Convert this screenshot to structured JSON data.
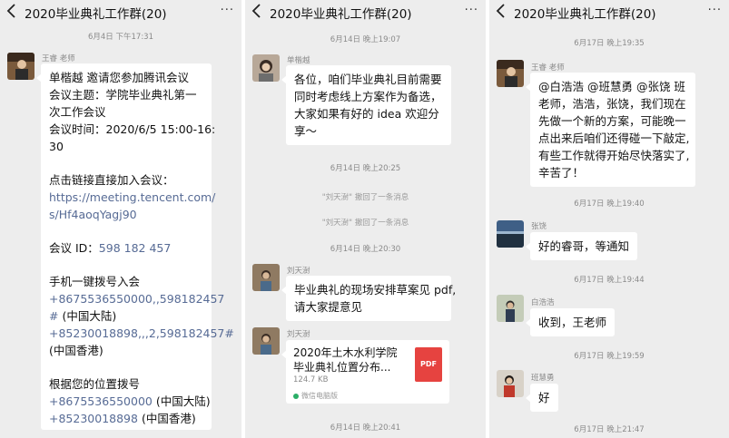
{
  "panels": [
    {
      "title": "2020毕业典礼工作群(20)",
      "more": "···",
      "timestamp": "6月4日 下午17:31",
      "sender": "王睿 老师",
      "lines": [
        "单楷越 邀请您参加腾讯会议",
        "会议主题：学院毕业典礼第一",
        "次工作会议",
        "会议时间：2020/6/5 15:00-16:",
        "30",
        "",
        "点击链接直接加入会议：",
        "https://meeting.tencent.com/",
        "s/Hf4aoqYagj90",
        "",
        "会议 ID：",
        "",
        "手机一键拨号入会",
        "+8675536550000,,598182457",
        "#",
        "+85230018898,,,2,598182457#",
        " (中国香港)",
        "",
        "根据您的位置拨号",
        "+8675536550000",
        "+85230018898"
      ],
      "meeting_id": "598 182 457",
      "cn_mainland_suffix": " (中国大陆)",
      "cn_mainland": " (中国大陆)",
      "hk": " (中国香港)"
    },
    {
      "title": "2020毕业典礼工作群(20)",
      "more": "···",
      "t1": "6月14日 晚上19:07",
      "sender1": "单楷越",
      "msg1": [
        "各位，咱们毕业典礼目前需要",
        "同时考虑线上方案作为备选，",
        "大家如果有好的 idea 欢迎分",
        "享～"
      ],
      "t2": "6月14日 晚上20:25",
      "recall1": "\"刘天澍\" 撤回了一条消息",
      "recall2": "\"刘天澍\" 撤回了一条消息",
      "t3": "6月14日 晚上20:30",
      "sender2": "刘天澍",
      "msg2": [
        "毕业典礼的现场安排草案见 pdf,",
        "请大家提意见"
      ],
      "sender3": "刘天澍",
      "file_name_1": "2020年土木水利学院",
      "file_name_2": "毕业典礼位置分布...",
      "file_size": "124.7 KB",
      "file_badge": "PDF",
      "file_source": "微信电脑版",
      "t4": "6月14日 晚上20:41"
    },
    {
      "title": "2020毕业典礼工作群(20)",
      "more": "···",
      "t1": "6月17日 晚上19:35",
      "sender1": "王睿 老师",
      "msg1": [
        "@白浩浩 @班慧勇 @张饶  班",
        "老师，浩浩，张饶，我们现在",
        "先做一个新的方案，可能晚一",
        "点出来后咱们还得碰一下敲定,",
        "有些工作就得开始尽快落实了,",
        "辛苦了！"
      ],
      "t2": "6月17日 晚上19:40",
      "sender2": "张饶",
      "msg2": "好的睿哥，等通知",
      "t3": "6月17日 晚上19:44",
      "sender3": "白浩浩",
      "msg3": "收到，王老师",
      "t4": "6月17日 晚上19:59",
      "sender4": "班慧勇",
      "msg4": "好",
      "t5": "6月17日 晚上21:47"
    }
  ]
}
